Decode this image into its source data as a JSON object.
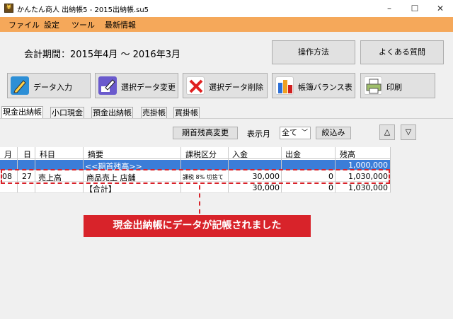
{
  "window": {
    "title": "かんたん商人 出納帳5 - 2015出納帳.su5",
    "minimize": "–",
    "maximize": "☐",
    "close": "✕"
  },
  "menu": [
    "ファイル",
    "設定",
    "ツール",
    "最新情報"
  ],
  "period": "会計期間：2015年4月 〜 2016年3月",
  "top_buttons": {
    "howto": "操作方法",
    "faq": "よくある質問"
  },
  "toolbar": [
    {
      "label": "データ入力",
      "icon": "pencil-icon"
    },
    {
      "label": "選択データ変更",
      "icon": "edit-icon"
    },
    {
      "label": "選択データ削除",
      "icon": "delete-x-icon"
    },
    {
      "label": "帳簿バランス表",
      "icon": "bar-chart-icon"
    },
    {
      "label": "印刷",
      "icon": "printer-icon"
    }
  ],
  "tabs": [
    "現金出納帳",
    "小口現金",
    "預金出納帳",
    "売掛帳",
    "買掛帳"
  ],
  "filter": {
    "opening_balance_btn": "期首残高変更",
    "month_label": "表示月",
    "month_value": "全て",
    "narrow_btn": "絞込み",
    "up": "△",
    "down": "▽"
  },
  "table": {
    "headers": [
      "月",
      "日",
      "科目",
      "摘要",
      "課税区分",
      "入金",
      "出金",
      "残高"
    ],
    "rows": [
      {
        "month": "",
        "day": "",
        "account": "",
        "desc": "<<期首残高>>",
        "tax": "",
        "in": "",
        "out": "",
        "balance": "1,000,000"
      },
      {
        "month": "08",
        "day": "27",
        "account": "売上高",
        "desc": "商品売上 店舗",
        "tax": "課税 8% 切捨て",
        "in": "30,000",
        "out": "0",
        "balance": "1,030,000"
      },
      {
        "month": "",
        "day": "",
        "account": "",
        "desc": "【合計】",
        "tax": "",
        "in": "30,000",
        "out": "0",
        "balance": "1,030,000"
      }
    ]
  },
  "callout": "現金出納帳にデータが記帳されました",
  "colors": {
    "menubar": "#f5a85a",
    "highlight": "#d8232a",
    "selected_row": "#3b7dd8"
  }
}
